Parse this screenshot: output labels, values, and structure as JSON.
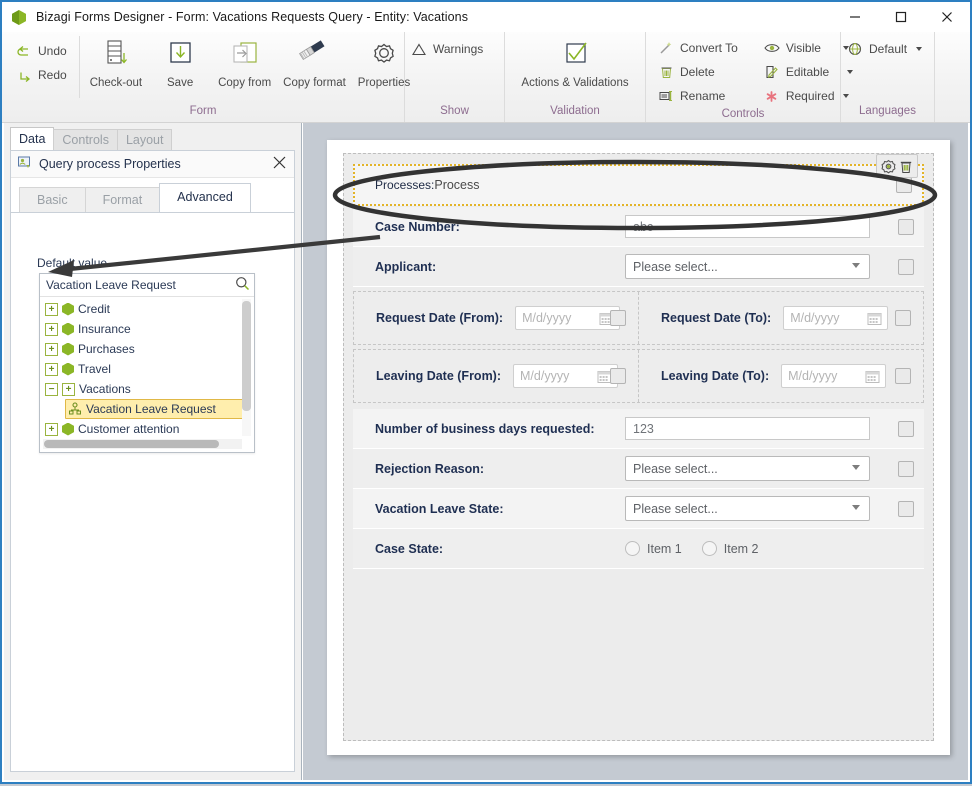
{
  "window": {
    "title": "Bizagi Forms Designer  - Form: Vacations Requests Query - Entity:  Vacations",
    "app_icon": "bizagi-hexagon-icon",
    "minimize": "—",
    "maximize": "□",
    "close": "✕"
  },
  "ribbon": {
    "groups": [
      {
        "name": "Form",
        "title": "Form",
        "quick": [
          {
            "label": "Undo",
            "icon": "undo-arrow-icon"
          },
          {
            "label": "Redo",
            "icon": "redo-arrow-icon"
          }
        ],
        "buttons": [
          {
            "label": "Check-out",
            "icon": "check-out-icon"
          },
          {
            "label": "Save",
            "icon": "save-download-icon"
          },
          {
            "label": "Copy from",
            "icon": "copy-from-icon"
          },
          {
            "label": "Copy format",
            "icon": "copy-format-brush-icon"
          },
          {
            "label": "Properties",
            "icon": "properties-gear-icon"
          }
        ]
      },
      {
        "name": "Show",
        "title": "Show",
        "items": [
          {
            "label": "Warnings",
            "icon": "warning-triangle-icon"
          }
        ]
      },
      {
        "name": "Validation",
        "title": "Validation",
        "buttons": [
          {
            "label": "Actions & Validations",
            "icon": "checkmark-box-icon"
          }
        ]
      },
      {
        "name": "Controls",
        "title": "Controls",
        "col1": [
          {
            "label": "Convert To",
            "icon": "convert-wand-icon",
            "caret": false
          },
          {
            "label": "Delete",
            "icon": "trash-icon",
            "caret": false
          },
          {
            "label": "Rename",
            "icon": "rename-tag-icon",
            "caret": false
          }
        ],
        "col2": [
          {
            "label": "Visible",
            "icon": "eye-icon",
            "caret": true
          },
          {
            "label": "Editable",
            "icon": "pencil-page-icon",
            "caret": true
          },
          {
            "label": "Required",
            "icon": "asterisk-icon",
            "caret": true
          }
        ]
      },
      {
        "name": "Languages",
        "title": "Languages",
        "items": [
          {
            "label": "Default",
            "icon": "globe-icon",
            "caret": true
          }
        ]
      }
    ]
  },
  "left_panel": {
    "tabs": [
      {
        "label": "Data",
        "active": true
      },
      {
        "label": "Controls",
        "active": false
      },
      {
        "label": "Layout",
        "active": false
      }
    ],
    "properties": {
      "header_title": "Query process Properties",
      "header_icon": "query-process-icon",
      "close_icon": "close-icon",
      "subtabs": [
        {
          "label": "Basic",
          "active": false
        },
        {
          "label": "Format",
          "active": false
        },
        {
          "label": "Advanced",
          "active": true
        }
      ],
      "default_value_label": "Default value",
      "search": {
        "value": "Vacation Leave Request",
        "placeholder": "",
        "icon": "search-magnifier-icon"
      },
      "tree": [
        {
          "label": "Credit",
          "indent": 0,
          "expander": "+",
          "icon": "entity-hexagon-icon",
          "selected": false
        },
        {
          "label": "Insurance",
          "indent": 0,
          "expander": "+",
          "icon": "entity-hexagon-icon",
          "selected": false
        },
        {
          "label": "Purchases",
          "indent": 0,
          "expander": "+",
          "icon": "entity-hexagon-icon",
          "selected": false
        },
        {
          "label": "Travel",
          "indent": 0,
          "expander": "+",
          "icon": "entity-hexagon-icon",
          "selected": false
        },
        {
          "label": "Vacations",
          "indent": 0,
          "expander": "-",
          "icon": "folder-plus-icon",
          "selected": false
        },
        {
          "label": "Vacation Leave Request",
          "indent": 1,
          "expander": "",
          "icon": "process-node-icon",
          "selected": true
        },
        {
          "label": "Customer attention",
          "indent": 0,
          "expander": "+",
          "icon": "entity-hexagon-icon",
          "selected": false
        }
      ]
    }
  },
  "form": {
    "processes_row": {
      "label": "Processes:",
      "value": "Process",
      "tools": [
        {
          "name": "configure-gear-icon"
        },
        {
          "name": "delete-trash-icon"
        }
      ],
      "selected": true
    },
    "rows": [
      {
        "label": "Case Number:",
        "control": "text",
        "value": "abc"
      },
      {
        "label": "Applicant:",
        "control": "select",
        "value": "Please select..."
      }
    ],
    "date_pairs": [
      {
        "left": {
          "label": "Request Date (From):",
          "value": "",
          "placeholder": "M/d/yyyy"
        },
        "right": {
          "label": "Request Date (To):",
          "value": "",
          "placeholder": "M/d/yyyy"
        }
      },
      {
        "left": {
          "label": "Leaving Date (From):",
          "value": "",
          "placeholder": "M/d/yyyy"
        },
        "right": {
          "label": "Leaving Date (To):",
          "value": "",
          "placeholder": "M/d/yyyy"
        }
      }
    ],
    "rows2": [
      {
        "label": "Number of business days requested:",
        "control": "text",
        "value": "123"
      },
      {
        "label": "Rejection Reason:",
        "control": "select",
        "value": "Please select..."
      },
      {
        "label": "Vacation Leave State:",
        "control": "select",
        "value": "Please select..."
      }
    ],
    "case_state": {
      "label": "Case State:",
      "options": [
        "Item 1",
        "Item 2"
      ]
    }
  },
  "annotations": {
    "highlight_shape": "black-rounded-ellipse-around-processes-row",
    "arrow": "black-arrow-from-processes-row-to-search-field"
  },
  "colors": {
    "accent_green": "#8bb626",
    "selection_yellow": "#ffeead",
    "selection_border": "#e3b428",
    "window_border_blue": "#2d7fc1",
    "label_navy": "#1f2f52",
    "group_title_purple": "#8d6c8f"
  }
}
